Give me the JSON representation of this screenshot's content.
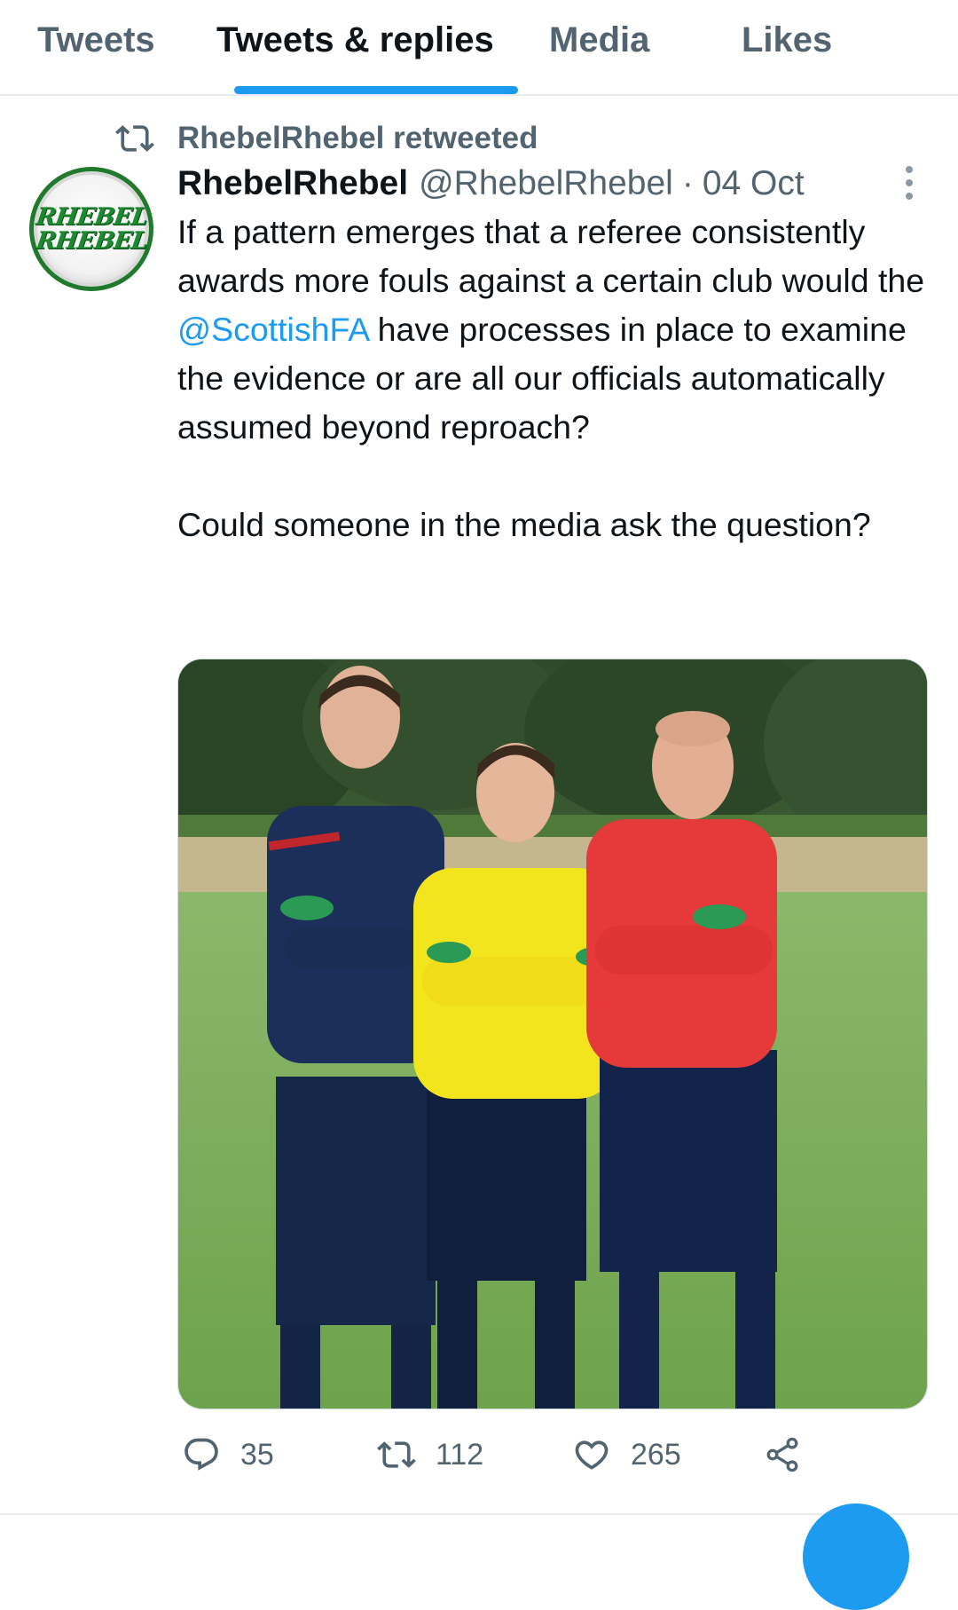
{
  "tabs": [
    {
      "label": "Tweets",
      "active": false
    },
    {
      "label": "Tweets & replies",
      "active": true
    },
    {
      "label": "Media",
      "active": false
    },
    {
      "label": "Likes",
      "active": false
    }
  ],
  "retweet_context": {
    "icon": "retweet-icon",
    "text": "RhebelRhebel retweeted"
  },
  "tweet": {
    "avatar": {
      "icon": "rhebel-logo",
      "logo_lines": [
        "RHEBEL",
        "RHEBEL"
      ]
    },
    "display_name": "RhebelRhebel",
    "handle": "@RhebelRhebel",
    "separator": "·",
    "date": "04 Oct",
    "more_icon": "more-vertical-icon",
    "text": {
      "p1_before": "If a pattern emerges that a referee consistently awards more fouls against a certain club would the ",
      "mention": "@ScottishFA",
      "p1_after": " have processes in place to examine the evidence or are all our officials automatically assumed beyond reproach?",
      "p2": "Could someone in the media ask the question?"
    },
    "media": {
      "kind": "photo",
      "description_icon": "photo-three-referees"
    },
    "actions": {
      "reply": {
        "icon": "reply-icon",
        "count": "35"
      },
      "retweet": {
        "icon": "retweet-icon",
        "count": "112"
      },
      "like": {
        "icon": "heart-icon",
        "count": "265"
      },
      "share": {
        "icon": "share-icon"
      }
    }
  },
  "colors": {
    "accent": "#1d9bf0",
    "text_primary": "#0f1419",
    "text_secondary": "#536471",
    "divider": "#e6ecf0",
    "avatar_green": "#1c8a2e"
  }
}
